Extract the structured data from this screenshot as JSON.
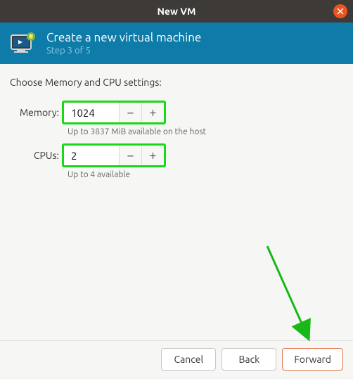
{
  "titlebar": {
    "title": "New VM"
  },
  "header": {
    "title": "Create a new virtual machine",
    "step": "Step 3 of 5"
  },
  "content": {
    "prompt": "Choose Memory and CPU settings:",
    "memory": {
      "label": "Memory:",
      "value": "1024",
      "hint": "Up to 3837 MiB available on the host"
    },
    "cpus": {
      "label": "CPUs:",
      "value": "2",
      "hint": "Up to 4 available"
    }
  },
  "footer": {
    "cancel": "Cancel",
    "back": "Back",
    "forward": "Forward"
  }
}
